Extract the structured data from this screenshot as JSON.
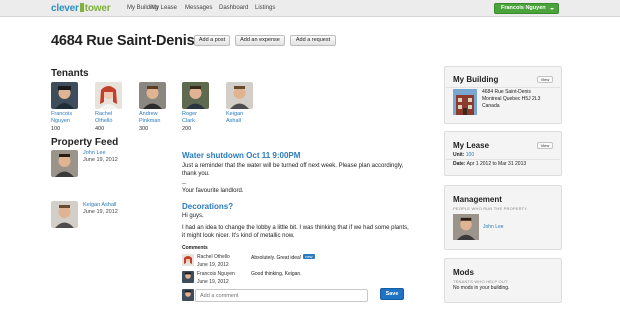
{
  "logo": {
    "left": "clever",
    "right": "tower"
  },
  "nav": [
    "My Building",
    "My Lease",
    "Messages",
    "Dashboard",
    "Listings"
  ],
  "user": {
    "name": "Francois Nguyen"
  },
  "page": {
    "title": "4684 Rue Saint-Denis"
  },
  "actions": [
    "Add a post",
    "Add an expense",
    "Add a request"
  ],
  "tenants": {
    "heading": "Tenants",
    "items": [
      {
        "first": "Francois",
        "last": "Nguyen",
        "number": "100"
      },
      {
        "first": "Rachel",
        "last": "Othello",
        "number": "400"
      },
      {
        "first": "Andrew",
        "last": "Pinkman",
        "number": "300"
      },
      {
        "first": "Roger",
        "last": "Clark",
        "number": "200"
      },
      {
        "first": "Keigan",
        "last": "Ashall",
        "number": ""
      }
    ]
  },
  "feed": {
    "heading": "Property Feed",
    "posts": [
      {
        "author": "John Lee",
        "date": "June 19, 2012",
        "title": "Water shutdown Oct 11 9:00PM",
        "body1": "Just a reminder that the water will be turned off next week. Please plan accordingly,",
        "body2": "thank you.",
        "sig_dash": "--",
        "sig": "Your favourite landlord."
      },
      {
        "author": "Keigan Ashall",
        "date": "June 19, 2012",
        "title": "Decorations?",
        "greeting": "Hi guys,",
        "body1": "I had an idea to change the lobby a little bit. I was thinking that if we had some plants,",
        "body2": "it might look nicer. It's kind of metallic now.",
        "comments_label": "Comments",
        "comments": [
          {
            "name": "Rachel Othello",
            "date": "June 19, 2012",
            "text": "Absolutely. Great idea!",
            "badge": "new"
          },
          {
            "name": "Francois Nguyen",
            "date": "June 19, 2012",
            "text": "Good thinking, Keigan."
          }
        ],
        "comment_placeholder": "Add a comment",
        "save_label": "Save"
      }
    ]
  },
  "sidebar": {
    "building": {
      "title": "My Building",
      "view": "View",
      "address1": "4684 Rue Saint-Denis",
      "address2": "Montreal  Quebec  H5J 2L3",
      "address3": "Canada"
    },
    "lease": {
      "title": "My Lease",
      "view": "View",
      "unit_label": "Unit:",
      "unit_value": "100",
      "date_label": "Date:",
      "date_value": "Apr 1 2012 to Mar 31 2013"
    },
    "management": {
      "title": "Management",
      "sub": "PEOPLE WHO RUN THE PROPERTY",
      "person": "John Lee"
    },
    "mods": {
      "title": "Mods",
      "sub": "TENANTS WHO HELP OUT",
      "text": "No mods in your building."
    }
  },
  "colors": {
    "link": "#2a7bbf",
    "primary_button": "#1f73c4",
    "user_button": "#4aa33b",
    "logo_blue": "#2f8fbf",
    "logo_green": "#7fb13c"
  }
}
